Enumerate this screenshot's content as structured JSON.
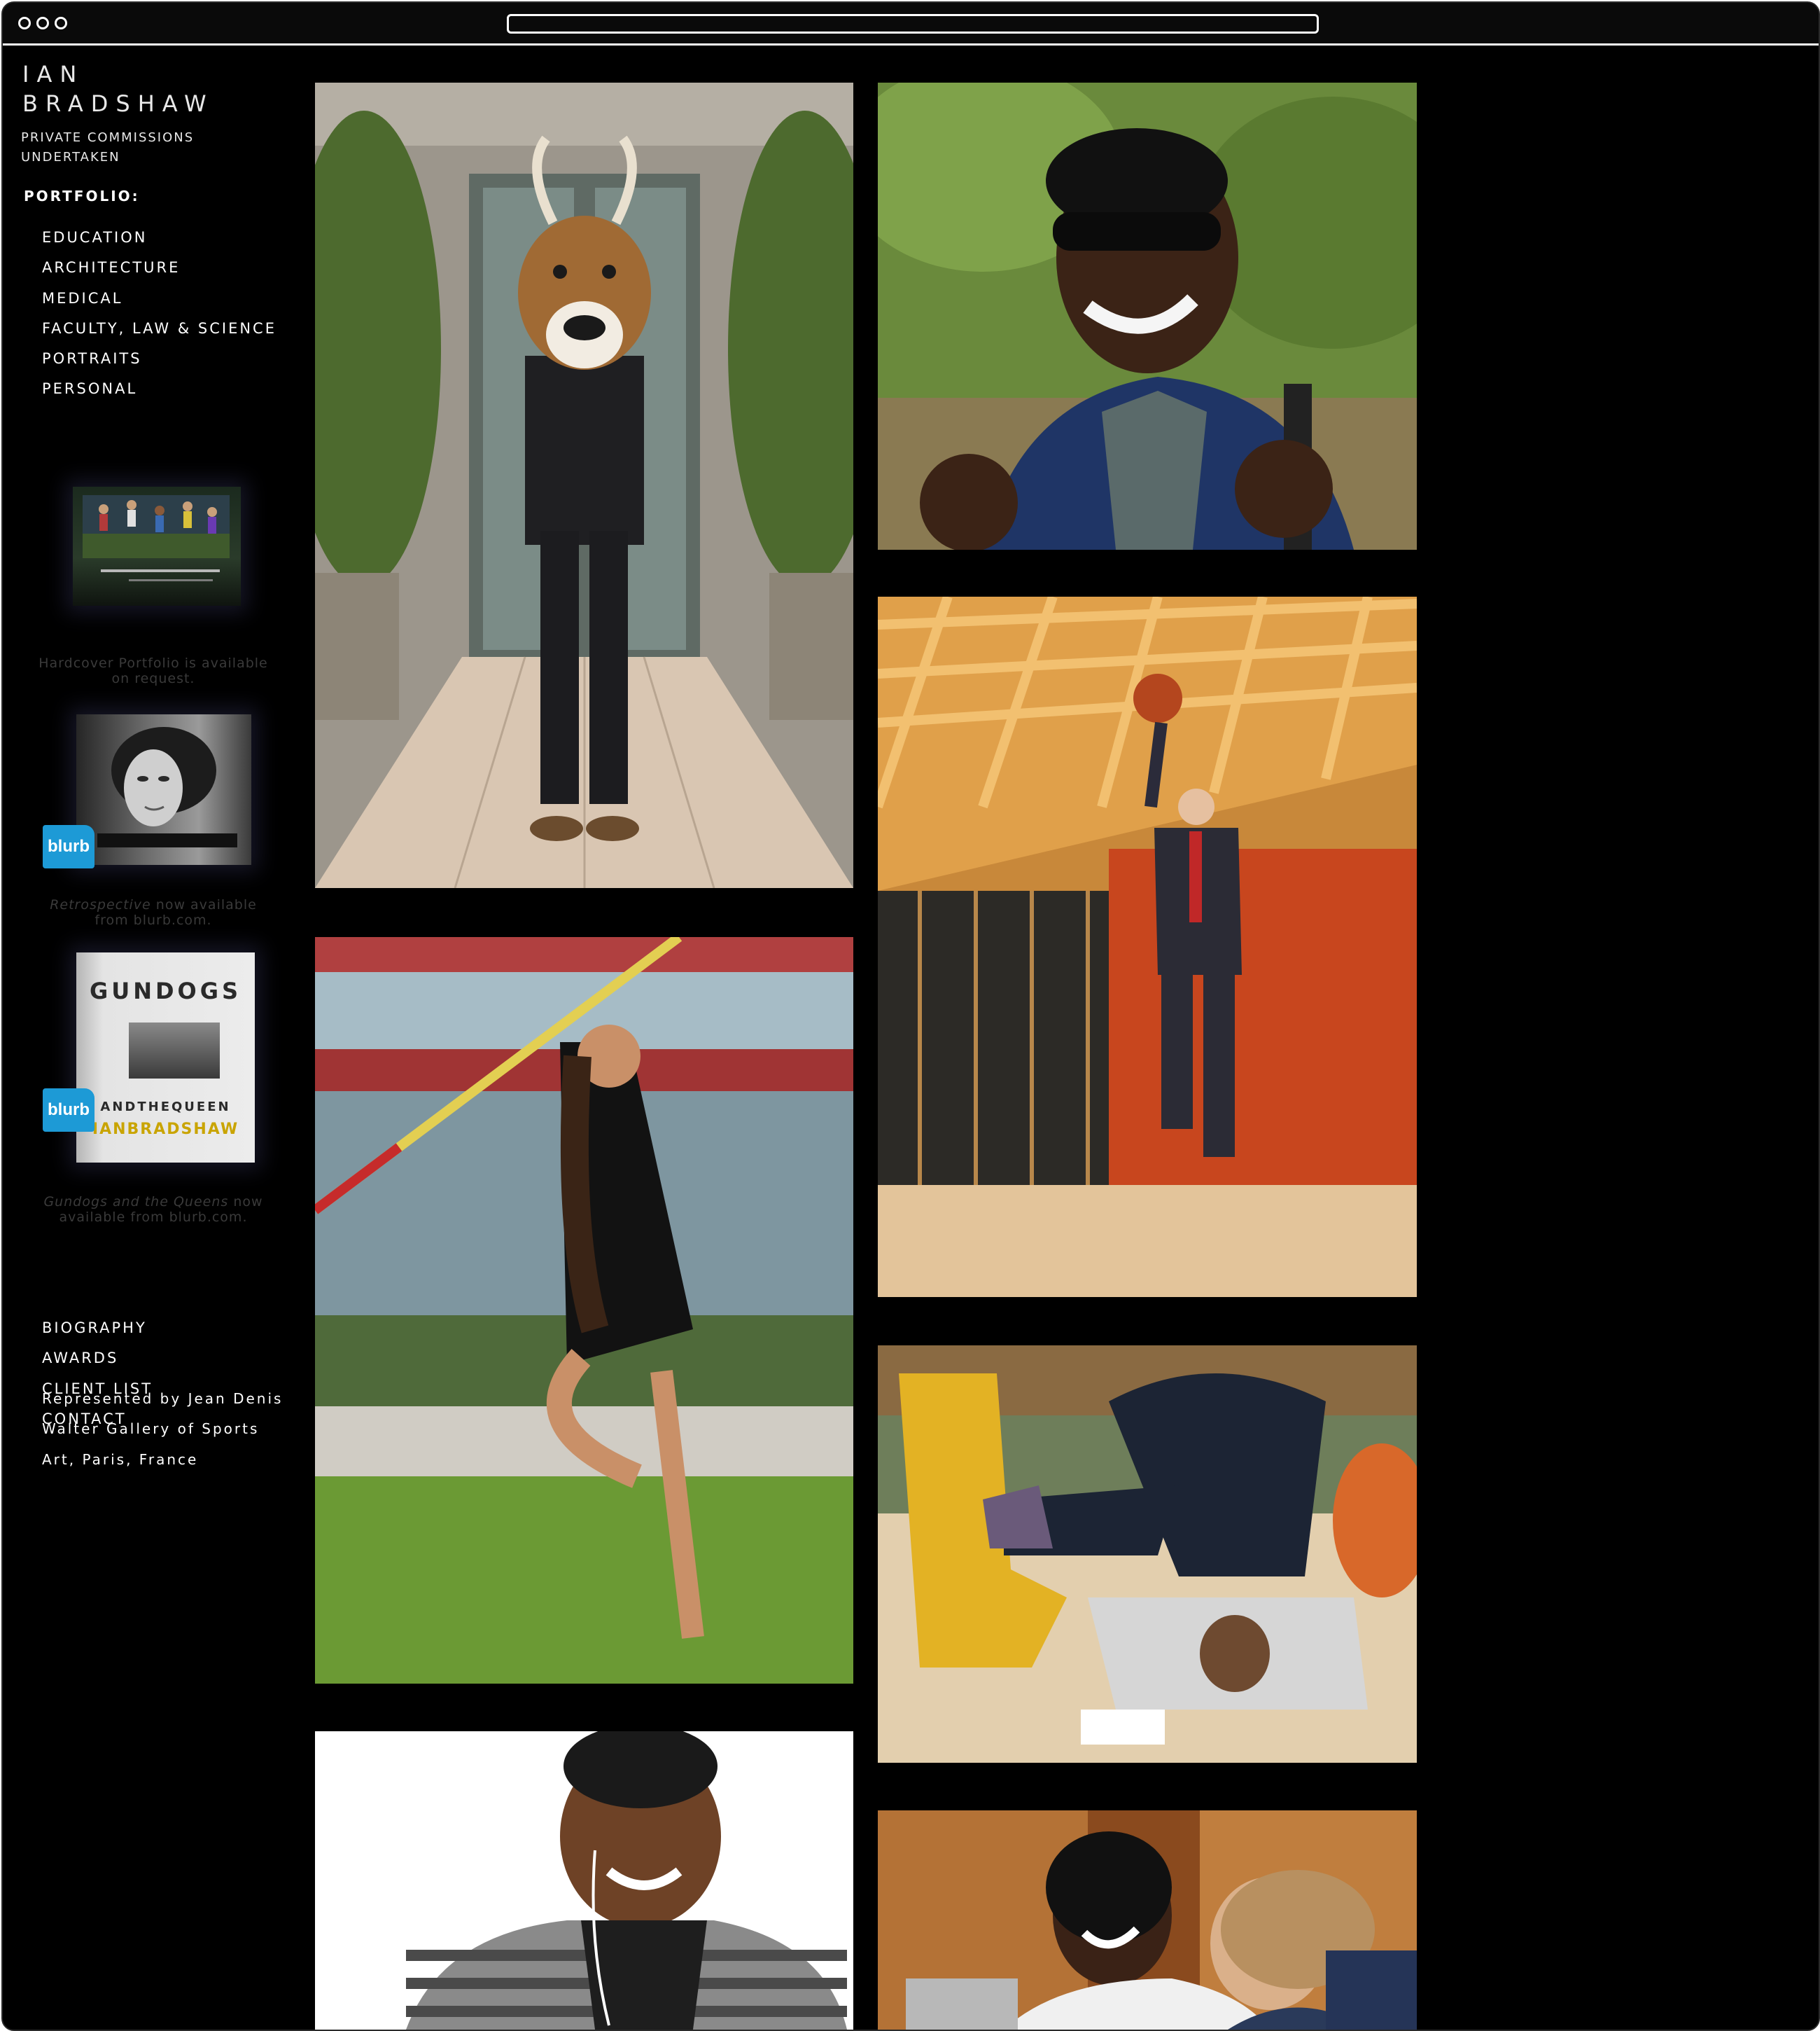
{
  "browser": {
    "url": ""
  },
  "header": {
    "name_line1": "IAN",
    "name_line2": "BRADSHAW",
    "tagline_line1": "PRIVATE COMMISSIONS",
    "tagline_line2": "UNDERTAKEN"
  },
  "portfolio": {
    "heading": "PORTFOLIO:",
    "items": [
      {
        "label": "EDUCATION"
      },
      {
        "label": "ARCHITECTURE"
      },
      {
        "label": "MEDICAL"
      },
      {
        "label": "FACULTY, LAW & SCIENCE"
      },
      {
        "label": "PORTRAITS"
      },
      {
        "label": "PERSONAL"
      }
    ]
  },
  "books": {
    "hardcover_caption": "Hardcover Portfolio is available on request.",
    "retro_title": "Retrospective",
    "retro_rest": " now available from blurb.com.",
    "gundogs_title": "Gundogs and the Queens",
    "gundogs_rest": " now available from blurb.com.",
    "blurb_label": "blurb",
    "gundogs_cover_title": "GUNDOGS",
    "gundogs_cover_sub": "ANDTHEQUEEN",
    "gundogs_cover_author": "IANBRADSHAW"
  },
  "info_nav": {
    "items": [
      {
        "label": "BIOGRAPHY"
      },
      {
        "label": "AWARDS"
      },
      {
        "label": "CLIENT LIST"
      },
      {
        "label": "CONTACT"
      }
    ]
  },
  "representation": {
    "line1": "Represented by Jean Denis",
    "line2": "Walter Gallery of Sports",
    "line3": "Art, Paris, France"
  },
  "gallery": {
    "photos": [
      {
        "name": "photo-mascot-deer-head"
      },
      {
        "name": "photo-man-sunglasses-cheering"
      },
      {
        "name": "photo-businessman-basketball-jump"
      },
      {
        "name": "photo-pole-vaulter-woman"
      },
      {
        "name": "photo-breakdancer-headstand"
      },
      {
        "name": "photo-man-earphones-smiling"
      },
      {
        "name": "photo-students-laughing"
      }
    ]
  },
  "colors": {
    "background": "#000000",
    "nav_text": "#ffffff",
    "caption_text": "#3a3a3a",
    "blurb_blue": "#1d9ad6"
  }
}
